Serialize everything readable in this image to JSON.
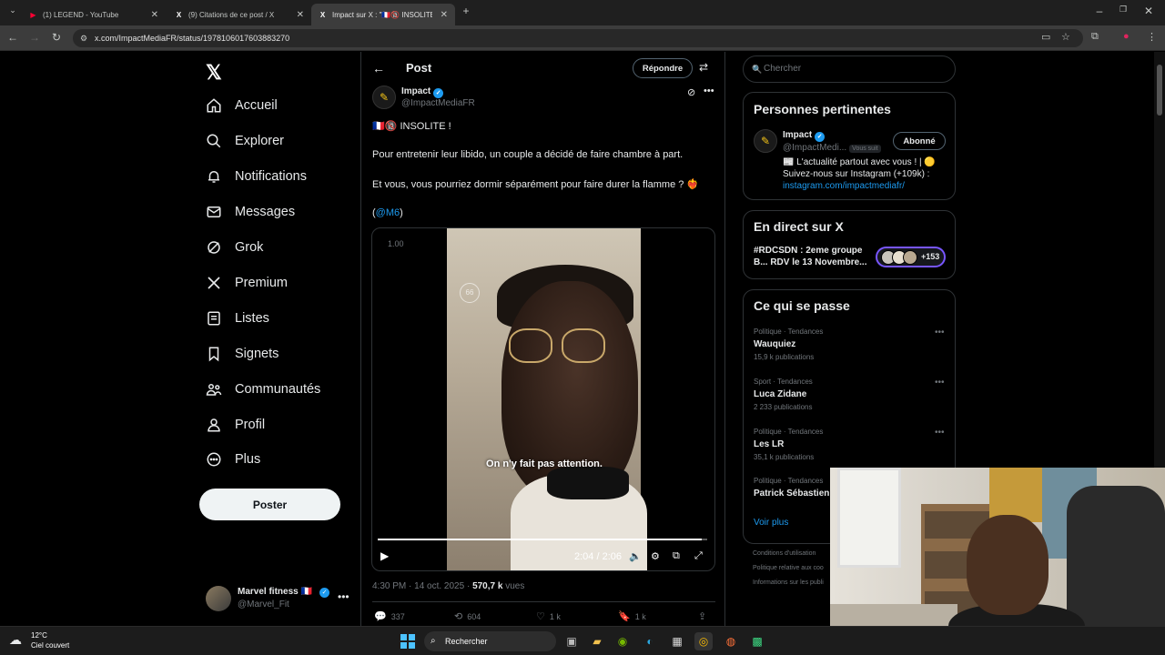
{
  "browser": {
    "tabs": [
      {
        "label": "(1) LEGEND - YouTube",
        "icon": "youtube-icon",
        "color": "#ff0033"
      },
      {
        "label": "(9) Citations de ce post / X",
        "icon": "x-icon",
        "color": "#ffffff"
      },
      {
        "label": "Impact sur X : \"🇫🇷🔞 INSOLITE !",
        "icon": "x-icon",
        "color": "#ffffff"
      }
    ],
    "url": "x.com/ImpactMediaFR/status/1978106017603883270"
  },
  "nav": {
    "items": [
      {
        "label": "Accueil",
        "icon": "home-icon"
      },
      {
        "label": "Explorer",
        "icon": "search-icon"
      },
      {
        "label": "Notifications",
        "icon": "bell-icon"
      },
      {
        "label": "Messages",
        "icon": "mail-icon"
      },
      {
        "label": "Grok",
        "icon": "grok-icon"
      },
      {
        "label": "Premium",
        "icon": "x-logo-icon"
      },
      {
        "label": "Listes",
        "icon": "list-icon"
      },
      {
        "label": "Signets",
        "icon": "bookmark-icon"
      },
      {
        "label": "Communautés",
        "icon": "communities-icon"
      },
      {
        "label": "Profil",
        "icon": "profile-icon"
      },
      {
        "label": "Plus",
        "icon": "more-circle-icon"
      }
    ],
    "post_button": "Poster",
    "account": {
      "name": "Marvel fitness 🇫🇷",
      "handle": "@Marvel_Fit"
    }
  },
  "post": {
    "header_title": "Post",
    "reply_button": "Répondre",
    "author_name": "Impact",
    "author_handle": "@ImpactMediaFR",
    "line1": "🇫🇷🔞 INSOLITE !",
    "line2": "Pour entretenir leur libido, un couple a décidé de faire chambre à part.",
    "line3": "Et vous, vous pourriez dormir séparément pour faire durer la flamme ? ❤️‍🔥",
    "mention_open": "(",
    "mention": "@M6",
    "mention_close": ")",
    "video": {
      "speed": "1.00",
      "watermark": "66",
      "subtitle": "On n'y fait pas attention.",
      "time": "2:04 / 2:06",
      "progress": 0.984
    },
    "timestamp": "4:30 PM · 14 oct. 2025 · ",
    "views_count": "570,7 k",
    "views_label": " vues",
    "actions": {
      "replies": "337",
      "reposts": "604",
      "likes": "1 k",
      "bookmarks": "1 k"
    }
  },
  "sidebar": {
    "search_placeholder": "Chercher",
    "relevant": {
      "title": "Personnes pertinentes",
      "name": "Impact",
      "handle": "@ImpactMedi...",
      "follows_you": "Vous suit",
      "follow_button": "Abonné",
      "bio1": "📰 L'actualité partout avec vous ! | 🟡",
      "bio2": "Suivez-nous sur Instagram (+109k) :",
      "bio_link": "instagram.com/impactmediafr/"
    },
    "live": {
      "title": "En direct sur X",
      "line1": "#RDCSDN : 2eme groupe",
      "line2": "B... RDV le 13 Novembre...",
      "count": "+153"
    },
    "trends": {
      "title": "Ce qui se passe",
      "items": [
        {
          "category": "Politique · Tendances",
          "name": "Wauquiez",
          "count": "15,9 k publications"
        },
        {
          "category": "Sport · Tendances",
          "name": "Luca Zidane",
          "count": "2 233 publications"
        },
        {
          "category": "Politique · Tendances",
          "name": "Les LR",
          "count": "35,1 k publications"
        },
        {
          "category": "Politique · Tendances",
          "name": "Patrick Sébastien",
          "count": ""
        }
      ],
      "see_more": "Voir plus"
    },
    "footer": [
      "Conditions d'utilisation",
      "Politique relative aux coo",
      "Informations sur les publi"
    ]
  },
  "taskbar": {
    "temp": "12°C",
    "weather": "Ciel couvert",
    "search": "Rechercher"
  }
}
